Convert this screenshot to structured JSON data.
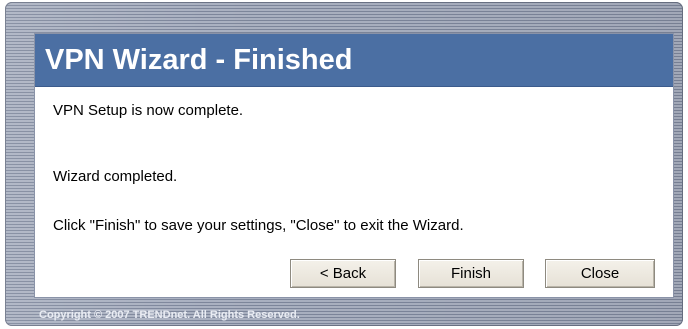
{
  "dialog": {
    "title": "VPN Wizard - Finished",
    "messages": [
      "VPN Setup is now complete.",
      "Wizard completed.",
      "Click \"Finish\" to save your settings, \"Close\" to exit the Wizard."
    ],
    "buttons": {
      "back": "< Back",
      "finish": "Finish",
      "close": "Close"
    }
  },
  "footer": {
    "copyright": "Copyright © 2007 TRENDnet. All Rights Reserved."
  },
  "colors": {
    "title_bar": "#4b6fa3",
    "frame": "#aab1c1",
    "dialog_bg": "#ffffff"
  }
}
